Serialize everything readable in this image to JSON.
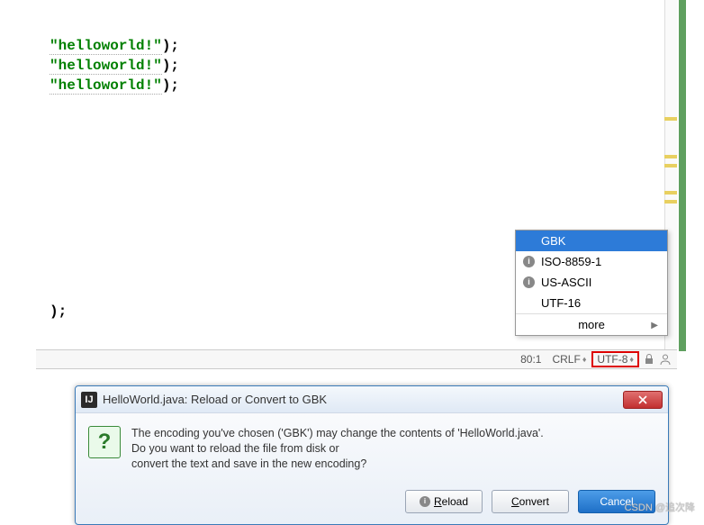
{
  "code": {
    "line1": "\"helloworld!\");",
    "line2": "\"helloworld!\");",
    "line3": "\"helloworld!\");",
    "fragment": ");"
  },
  "statusbar": {
    "position": "80:1",
    "lineending": "CRLF",
    "encoding": "UTF-8"
  },
  "encoding_menu": {
    "items": [
      {
        "label": "GBK",
        "selected": true,
        "info": false
      },
      {
        "label": "ISO-8859-1",
        "selected": false,
        "info": true
      },
      {
        "label": "US-ASCII",
        "selected": false,
        "info": true
      },
      {
        "label": "UTF-16",
        "selected": false,
        "info": false
      }
    ],
    "more": "more"
  },
  "dialog": {
    "icon_text": "IJ",
    "title": "HelloWorld.java: Reload or Convert to GBK",
    "message_l1": "The encoding you've chosen ('GBK') may change the contents of 'HelloWorld.java'.",
    "message_l2": "Do you want to reload the file from disk or",
    "message_l3": "convert the text and save in the new encoding?",
    "buttons": {
      "reload": "eload",
      "reload_u": "R",
      "convert": "onvert",
      "convert_u": "C",
      "cancel": "Cancel"
    }
  },
  "watermark": "CSDN @追次降"
}
